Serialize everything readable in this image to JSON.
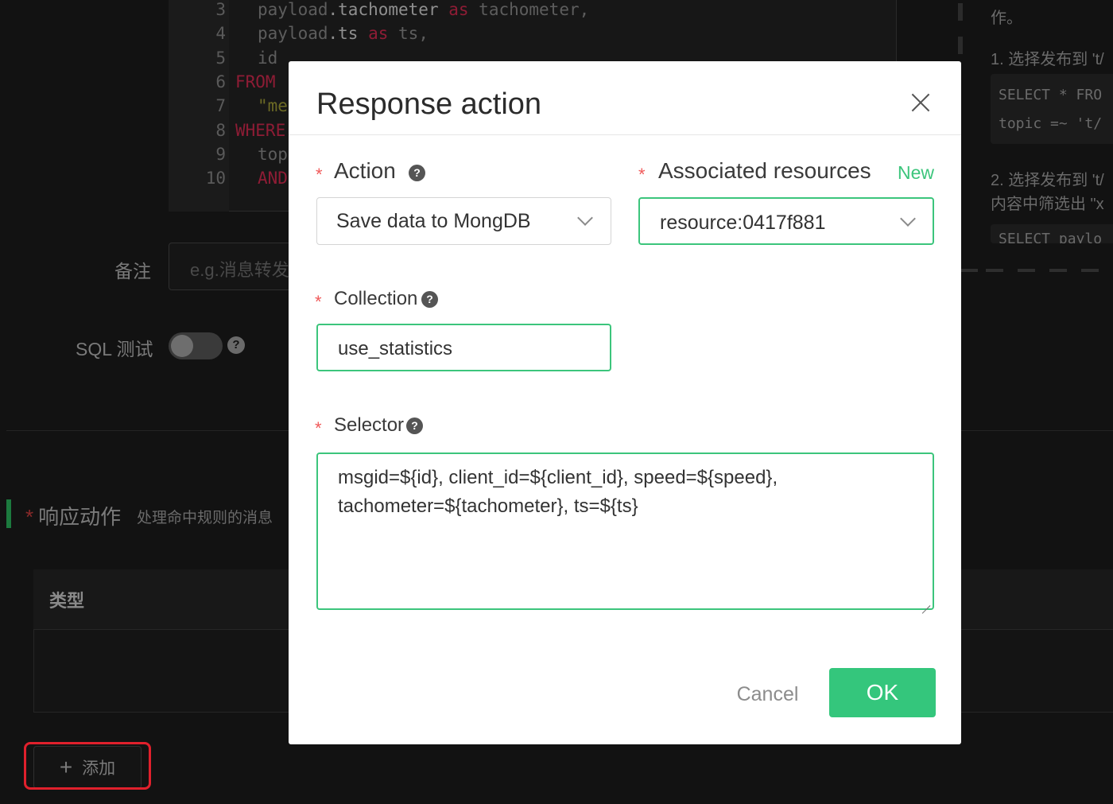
{
  "background": {
    "code_lines": [
      {
        "num": "3",
        "tokens": [
          {
            "t": "payload",
            "c": "var"
          },
          {
            "t": ".tachometer ",
            "c": "w"
          },
          {
            "t": "as",
            "c": "kw"
          },
          {
            "t": " tachometer,",
            "c": "var"
          }
        ]
      },
      {
        "num": "4",
        "tokens": [
          {
            "t": "payload",
            "c": "var"
          },
          {
            "t": ".ts ",
            "c": "w"
          },
          {
            "t": "as",
            "c": "kw"
          },
          {
            "t": " ts,",
            "c": "var"
          }
        ]
      },
      {
        "num": "5",
        "tokens": [
          {
            "t": "id",
            "c": "var"
          }
        ]
      },
      {
        "num": "6",
        "tokens": [
          {
            "t": "FROM",
            "c": "kw"
          }
        ]
      },
      {
        "num": "7",
        "tokens": [
          {
            "t": "\"me",
            "c": "str"
          }
        ]
      },
      {
        "num": "8",
        "tokens": [
          {
            "t": "WHERE",
            "c": "kw"
          }
        ]
      },
      {
        "num": "9",
        "tokens": [
          {
            "t": "top",
            "c": "var"
          }
        ]
      },
      {
        "num": "10",
        "tokens": [
          {
            "t": "AND",
            "c": "kw"
          }
        ]
      }
    ],
    "remark_label": "备注",
    "remark_placeholder": "e.g.消息转发",
    "sql_test_label": "SQL 测试",
    "help_glyph": "?",
    "section_star": "*",
    "section_title": "响应动作",
    "section_subtitle": "处理命中规则的消息",
    "table_header_type": "类型",
    "add_button_plus": "+",
    "add_button_label": "添加",
    "right_panel": {
      "line1": "作。",
      "line2": "1. 选择发布到 't/",
      "code1_line1": "SELECT * FRO",
      "code1_line2": "topic =~ 't/",
      "line3": "2. 选择发布到 't/",
      "line4": "内容中筛选出 \"x",
      "code2_line1": "SELECT paylo"
    }
  },
  "modal": {
    "title": "Response action",
    "required_mark": "*",
    "action_label": "Action",
    "action_value": "Save data to MongDB",
    "resources_label": "Associated resources",
    "resources_new_link": "New",
    "resources_value": "resource:0417f881",
    "collection_label": "Collection",
    "collection_value": "use_statistics",
    "selector_label": "Selector",
    "selector_value": "msgid=${id}, client_id=${client_id}, speed=${speed}, tachometer=${tachometer}, ts=${ts}",
    "help_glyph": "?",
    "cancel_label": "Cancel",
    "ok_label": "OK"
  },
  "colors": {
    "accent_green": "#34c67c",
    "highlight_red": "#e0202c",
    "required_red": "#f05a5a"
  }
}
